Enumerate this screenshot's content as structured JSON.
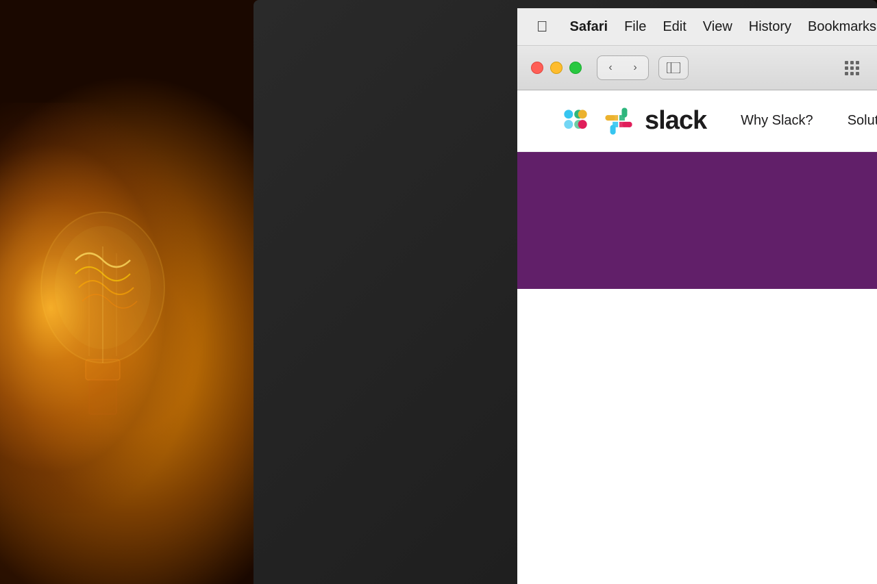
{
  "background": {
    "color": "#1a0800"
  },
  "menubar": {
    "apple_label": "",
    "items": [
      {
        "id": "safari",
        "label": "Safari",
        "bold": true
      },
      {
        "id": "file",
        "label": "File",
        "bold": false
      },
      {
        "id": "edit",
        "label": "Edit",
        "bold": false
      },
      {
        "id": "view",
        "label": "View",
        "bold": false
      },
      {
        "id": "history",
        "label": "History",
        "bold": false
      },
      {
        "id": "bookmarks",
        "label": "Bookmarks",
        "bold": false
      }
    ]
  },
  "toolbar": {
    "back_label": "‹",
    "forward_label": "›",
    "sidebar_label": "⊟",
    "grid_label": "⠿"
  },
  "website": {
    "logo_text": "slack",
    "nav_links": [
      {
        "id": "why-slack",
        "label": "Why Slack?"
      },
      {
        "id": "solutions",
        "label": "Solutio..."
      }
    ],
    "hero_color": "#611f69"
  }
}
